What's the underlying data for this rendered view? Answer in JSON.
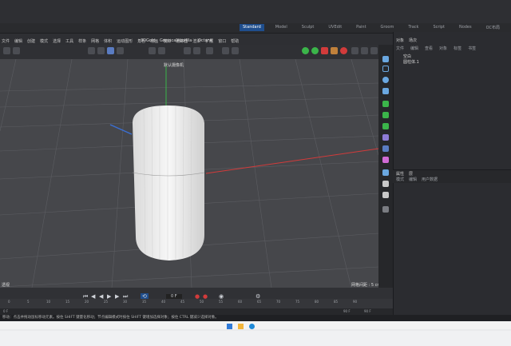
{
  "app": {
    "layouts": [
      "Standard",
      "Model",
      "Sculpt",
      "UVEdit",
      "Paint",
      "Groom",
      "Track",
      "Script",
      "Nodes",
      "OC布局"
    ],
    "active_layout": "Standard",
    "menu": [
      "文件",
      "编辑",
      "创建",
      "模式",
      "选择",
      "工具",
      "样条",
      "网格",
      "体积",
      "运动图形",
      "角色",
      "动画",
      "模拟",
      "跟踪器",
      "渲染",
      "扩展",
      "窗口",
      "帮助"
    ],
    "toolbar_labels": {
      "plugin1": "3DGold",
      "plugin2": "Greyscalegorilla",
      "plugin3": "Octane"
    },
    "viewport": {
      "camera": "默认摄像机",
      "grid_info": "网格间距 : 5 cm",
      "view_label": "透视"
    },
    "objects_panel": {
      "tabs": [
        "对象",
        "场次"
      ],
      "head": [
        "文件",
        "编辑",
        "查看",
        "对象",
        "标签",
        "书签"
      ],
      "items": [
        "空白",
        "圆柱体.1"
      ]
    },
    "attributes_panel": {
      "tabs": [
        "属性",
        "层"
      ],
      "sub": [
        "模式",
        "编辑",
        "用户数据"
      ]
    },
    "transport": {
      "frame_field": "0 F",
      "current_frame": "0 F",
      "end_frame": "90 F"
    },
    "timeline_ticks": [
      "0",
      "5",
      "10",
      "15",
      "20",
      "25",
      "30",
      "35",
      "40",
      "45",
      "50",
      "55",
      "60",
      "65",
      "70",
      "75",
      "80",
      "85",
      "90"
    ],
    "status_text": "移动：点击并拖动鼠标移动元素。按住 SHIFT 键量化移动；节点编辑模式时按住 SHIFT 键增加选择对象；按住 CTRL 键减少选择对象。",
    "colors": {
      "accent": "#1f4e8d",
      "viewport": "#46474b",
      "panel": "#2b2c30",
      "x_axis": "#d23b3b",
      "y_axis": "#3bb54a",
      "z_axis": "#3b6fd2"
    }
  }
}
